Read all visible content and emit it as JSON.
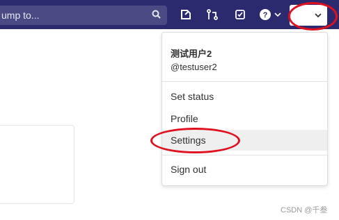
{
  "header": {
    "search_placeholder": "ump to...",
    "colors": {
      "bar": "#2b2a6e",
      "search_bg": "#4b4a84",
      "accent_ring": "#e0101f"
    },
    "icons": [
      "search-icon",
      "issues-icon",
      "merge-requests-icon",
      "todos-icon",
      "help-icon",
      "chevron-down-icon"
    ]
  },
  "user_menu": {
    "display_name": "测试用户2",
    "username": "@testuser2",
    "items": [
      {
        "label": "Set status"
      },
      {
        "label": "Profile"
      },
      {
        "label": "Settings",
        "highlighted": true
      },
      {
        "label": "Sign out"
      }
    ]
  },
  "watermark": "CSDN @千叁"
}
